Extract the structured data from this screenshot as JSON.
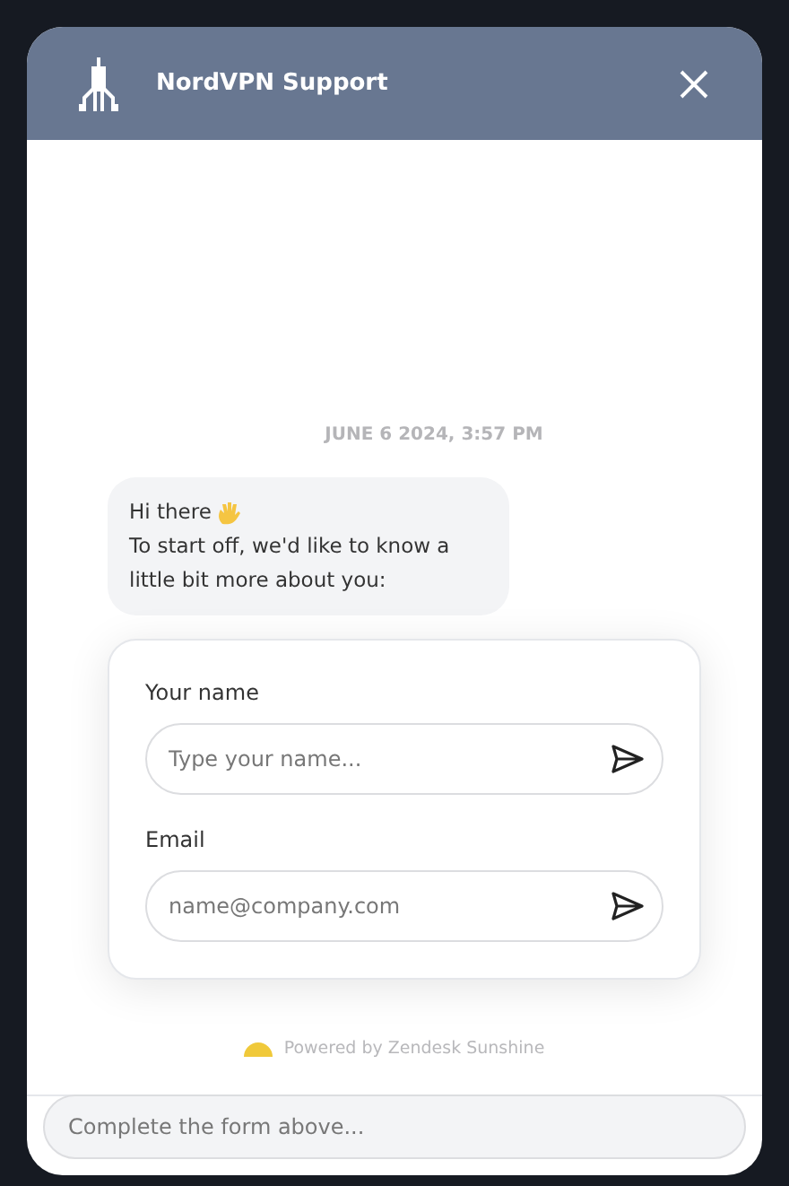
{
  "header": {
    "title": "NordVPN Support"
  },
  "timestamp": "JUNE 6 2024, 3:57 PM",
  "message": {
    "greeting": "Hi there",
    "lines": [
      "To start off, we'd like to know a",
      "little bit more about you:"
    ]
  },
  "form": {
    "fields": [
      {
        "label": "Your name",
        "placeholder": "Type your name..."
      },
      {
        "label": "Email",
        "placeholder": "name@company.com"
      }
    ]
  },
  "powered_by": "Powered by Zendesk Sunshine",
  "composer": {
    "placeholder": "Complete the form above..."
  }
}
